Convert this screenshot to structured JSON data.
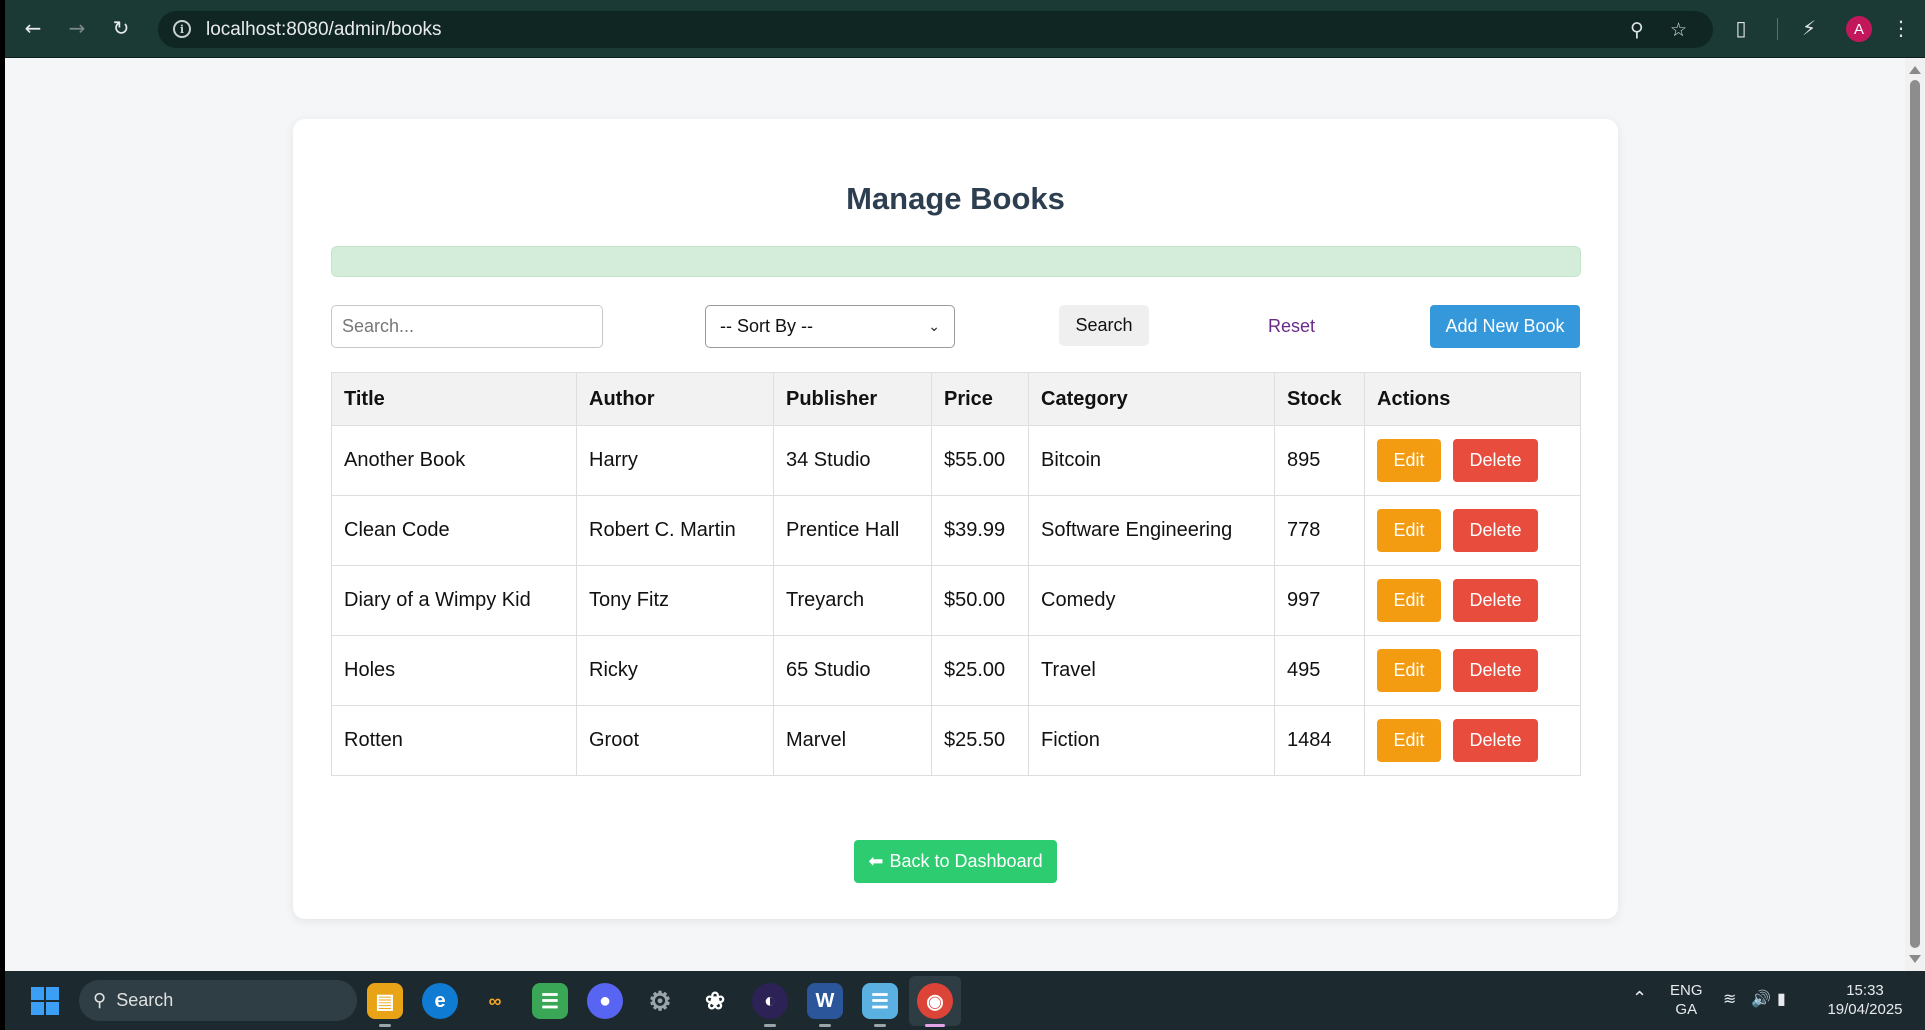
{
  "browser": {
    "url": "localhost:8080/admin/books",
    "avatar_letter": "A",
    "icons": [
      "back-icon",
      "forward-icon",
      "reload-icon",
      "info-icon",
      "zoom-icon",
      "star-icon",
      "extensions-icon",
      "performance-icon",
      "menu-icon"
    ]
  },
  "page": {
    "title": "Manage Books",
    "search_placeholder": "Search...",
    "sort_label": "-- Sort By --",
    "search_button": "Search",
    "reset_link": "Reset",
    "add_button": "Add New Book",
    "back_button": "Back to Dashboard",
    "back_icon": "⬅"
  },
  "table": {
    "headers": [
      "Title",
      "Author",
      "Publisher",
      "Price",
      "Category",
      "Stock",
      "Actions"
    ],
    "rows": [
      {
        "title": "Another Book",
        "author": "Harry",
        "publisher": "34 Studio",
        "price": "$55.00",
        "category": "Bitcoin",
        "stock": "895"
      },
      {
        "title": "Clean Code",
        "author": "Robert C. Martin",
        "publisher": "Prentice Hall",
        "price": "$39.99",
        "category": "Software Engineering",
        "stock": "778"
      },
      {
        "title": "Diary of a Wimpy Kid",
        "author": "Tony Fitz",
        "publisher": "Treyarch",
        "price": "$50.00",
        "category": "Comedy",
        "stock": "997"
      },
      {
        "title": "Holes",
        "author": "Ricky",
        "publisher": "65 Studio",
        "price": "$25.00",
        "category": "Travel",
        "stock": "495"
      },
      {
        "title": "Rotten",
        "author": "Groot",
        "publisher": "Marvel",
        "price": "$25.50",
        "category": "Fiction",
        "stock": "1484"
      }
    ],
    "edit_label": "Edit",
    "delete_label": "Delete"
  },
  "taskbar": {
    "search_label": "Search",
    "lang_line1": "ENG",
    "lang_line2": "GA",
    "time": "15:33",
    "date": "19/04/2025"
  },
  "colors": {
    "chrome_bg": "#1b3a36",
    "add_button": "#3498db",
    "edit_button": "#f39c12",
    "delete_button": "#e74c3c",
    "back_button": "#2ecc71",
    "alert_bg": "#d4edda"
  }
}
